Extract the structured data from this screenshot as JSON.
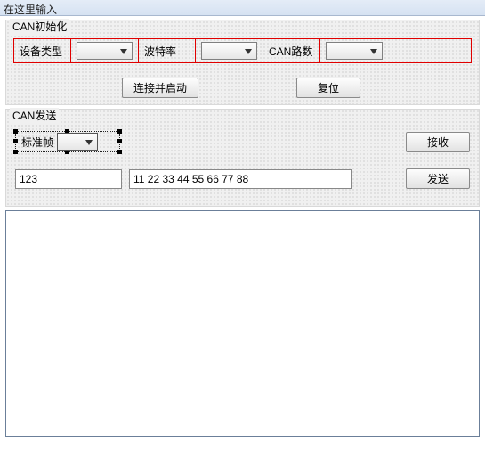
{
  "title_bar": "在这里输入",
  "init": {
    "group_label": "CAN初始化",
    "device_type_label": "设备类型",
    "baud_label": "波特率",
    "can_channel_label": "CAN路数",
    "device_type_value": "",
    "baud_value": "",
    "can_channel_value": "",
    "connect_btn": "连接并启动",
    "reset_btn": "复位"
  },
  "send": {
    "group_label": "CAN发送",
    "frame_type_label": "标准帧",
    "frame_type_value": "",
    "recv_btn": "接收",
    "send_btn": "发送",
    "id_value": "123",
    "data_value": "11 22 33 44 55 66 77 88"
  },
  "output": ""
}
